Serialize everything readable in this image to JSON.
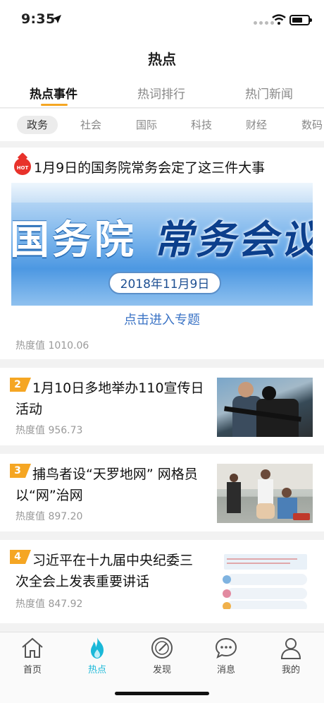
{
  "status_bar": {
    "time": "9:35",
    "icons": [
      "location-arrow-icon",
      "signal-dots-icon",
      "wifi-icon",
      "battery-icon"
    ]
  },
  "nav": {
    "title": "热点"
  },
  "tabs": [
    {
      "label": "热点事件",
      "active": true
    },
    {
      "label": "热词排行",
      "active": false
    },
    {
      "label": "热门新闻",
      "active": false
    }
  ],
  "categories": [
    "政务",
    "社会",
    "国际",
    "科技",
    "财经",
    "数码"
  ],
  "active_category": "政务",
  "accent_color": "#f5a623",
  "featured": {
    "badge": "HOT",
    "title": "1月9日的国务院常务会定了这三件大事",
    "banner_text_a": "国务院",
    "banner_text_b": "常务会议",
    "banner_date": "2018年11月9日",
    "link_text": "点击进入专题",
    "heat": "热度值 1010.06"
  },
  "news": [
    {
      "rank": "2",
      "title": "1月10日多地举办110宣传日活动",
      "heat": "热度值 956.73"
    },
    {
      "rank": "3",
      "title": "捕鸟者设“天罗地网” 网格员以“网”治网",
      "heat": "热度值 897.20"
    },
    {
      "rank": "4",
      "title": "习近平在十九届中央纪委三次全会上发表重要讲话",
      "heat": "热度值 847.92"
    }
  ],
  "tab_bar": [
    {
      "label": "首页",
      "icon": "home-icon",
      "active": false
    },
    {
      "label": "热点",
      "icon": "flame-icon",
      "active": true
    },
    {
      "label": "发现",
      "icon": "compass-icon",
      "active": false
    },
    {
      "label": "消息",
      "icon": "chat-bubble-icon",
      "active": false
    },
    {
      "label": "我的",
      "icon": "person-icon",
      "active": false
    }
  ],
  "active_tab_color": "#1ab8d8"
}
